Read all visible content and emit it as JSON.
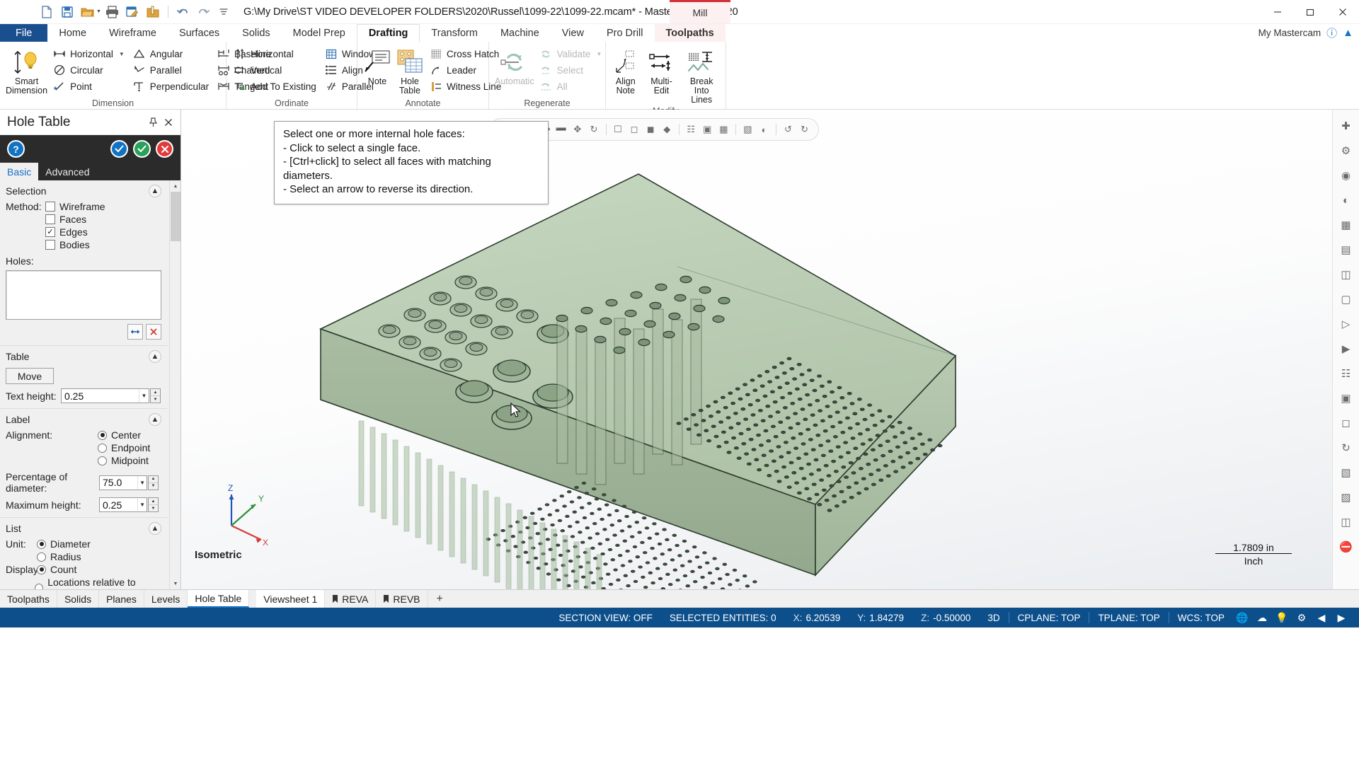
{
  "titlebar": {
    "quick_access": [
      {
        "name": "new-icon",
        "label": "New"
      },
      {
        "name": "save-icon",
        "label": "Save"
      },
      {
        "name": "open-folder-icon",
        "label": "Open"
      },
      {
        "name": "print-icon",
        "label": "Print"
      },
      {
        "name": "print-preview-icon",
        "label": "Print Preview"
      },
      {
        "name": "zip2go-icon",
        "label": "Zip2Go"
      },
      {
        "name": "undo-icon",
        "label": "Undo"
      },
      {
        "name": "redo-icon",
        "label": "Redo"
      },
      {
        "name": "customize-qat-icon",
        "label": "Customize Quick Access Toolbar"
      }
    ],
    "document_path": "G:\\My Drive\\ST VIDEO DEVELOPER FOLDERS\\2020\\Russel\\1099-22\\1099-22.mcam* - Mastercam Mill 2020",
    "machine_badge": "Mill",
    "window_controls": {
      "minimize": "–",
      "maximize": "❐",
      "close": "✕"
    }
  },
  "ribbon": {
    "tabs": [
      {
        "label": "File",
        "state": "file"
      },
      {
        "label": "Home",
        "state": "normal"
      },
      {
        "label": "Wireframe",
        "state": "normal"
      },
      {
        "label": "Surfaces",
        "state": "normal"
      },
      {
        "label": "Solids",
        "state": "normal"
      },
      {
        "label": "Model Prep",
        "state": "normal"
      },
      {
        "label": "Drafting",
        "state": "active"
      },
      {
        "label": "Transform",
        "state": "normal"
      },
      {
        "label": "Machine",
        "state": "normal"
      },
      {
        "label": "View",
        "state": "normal"
      },
      {
        "label": "Pro Drill",
        "state": "normal"
      },
      {
        "label": "Toolpaths",
        "state": "toolpaths"
      }
    ],
    "account_label": "My Mastercam",
    "groups": {
      "dimension": {
        "label": "Dimension",
        "big": {
          "label_line1": "Smart",
          "label_line2": "Dimension",
          "icon": "smart-dimension-icon"
        },
        "col1": [
          {
            "label": "Horizontal",
            "icon": "horizontal-dimension-icon",
            "dropdown": true
          },
          {
            "label": "Circular",
            "icon": "circular-dimension-icon",
            "dropdown": false
          },
          {
            "label": "Point",
            "icon": "point-dimension-icon",
            "dropdown": false
          }
        ],
        "col2": [
          {
            "label": "Angular",
            "icon": "angular-dimension-icon"
          },
          {
            "label": "Parallel",
            "icon": "parallel-dimension-icon"
          },
          {
            "label": "Perpendicular",
            "icon": "perpendicular-dimension-icon"
          }
        ],
        "col3": [
          {
            "label": "Baseline",
            "icon": "baseline-dimension-icon"
          },
          {
            "label": "Chained",
            "icon": "chained-dimension-icon"
          },
          {
            "label": "Tangent",
            "icon": "tangent-dimension-icon"
          }
        ]
      },
      "ordinate": {
        "label": "Ordinate",
        "items": [
          {
            "label": "Horizontal",
            "icon": "ordinate-horizontal-icon"
          },
          {
            "label": "Vertical",
            "icon": "ordinate-vertical-icon"
          },
          {
            "label": "Add To Existing",
            "icon": "add-to-existing-icon"
          },
          {
            "label": "Window",
            "icon": "window-icon"
          },
          {
            "label": "Align",
            "icon": "align-icon"
          },
          {
            "label": "Parallel",
            "icon": "ordinate-parallel-icon"
          }
        ]
      },
      "annotate": {
        "label": "Annotate",
        "big": [
          {
            "label_line1": "Note",
            "label_line2": "",
            "icon": "note-icon"
          },
          {
            "label_line1": "Hole",
            "label_line2": "Table",
            "icon": "hole-table-icon"
          }
        ],
        "items": [
          {
            "label": "Cross Hatch",
            "icon": "cross-hatch-icon"
          },
          {
            "label": "Leader",
            "icon": "leader-icon"
          },
          {
            "label": "Witness Line",
            "icon": "witness-line-icon"
          }
        ]
      },
      "regenerate": {
        "label": "Regenerate",
        "big": {
          "label_line1": "Automatic",
          "label_line2": "",
          "icon": "automatic-regen-icon",
          "disabled": true
        },
        "items": [
          {
            "label": "Validate",
            "icon": "validate-icon",
            "dropdown": true,
            "disabled": true
          },
          {
            "label": "Select",
            "icon": "select-regen-icon",
            "disabled": true
          },
          {
            "label": "All",
            "icon": "all-regen-icon",
            "disabled": true
          }
        ]
      },
      "modify": {
        "label": "Modify",
        "big": [
          {
            "label_line1": "Align",
            "label_line2": "Note",
            "icon": "align-note-icon"
          },
          {
            "label_line1": "Multi-Edit",
            "label_line2": "",
            "icon": "multi-edit-icon"
          },
          {
            "label_line1": "Break",
            "label_line2": "Into Lines",
            "icon": "break-into-lines-icon"
          }
        ]
      }
    }
  },
  "hole_table_panel": {
    "title": "Hole Table",
    "header_buttons": [
      {
        "name": "pin-icon",
        "glyph": "·|·"
      },
      {
        "name": "close-icon",
        "glyph": "✕"
      }
    ],
    "toolbar_buttons": [
      {
        "name": "help-button",
        "glyph": "?",
        "style": "cb-help"
      },
      {
        "name": "apply-button",
        "glyph": "✔",
        "style": "cb-apply"
      },
      {
        "name": "ok-button",
        "glyph": "✔",
        "style": "cb-ok"
      },
      {
        "name": "cancel-button",
        "glyph": "✕",
        "style": "cb-cancel"
      }
    ],
    "tabs": [
      {
        "label": "Basic",
        "active": true
      },
      {
        "label": "Advanced",
        "active": false
      }
    ],
    "sections": {
      "selection": {
        "title": "Selection",
        "method_label": "Method:",
        "methods": [
          {
            "label": "Wireframe",
            "checked": false
          },
          {
            "label": "Faces",
            "checked": false
          },
          {
            "label": "Edges",
            "checked": true
          },
          {
            "label": "Bodies",
            "checked": false
          }
        ],
        "holes_label": "Holes:",
        "holes_value": "",
        "action_buttons": [
          {
            "name": "reverse-direction-button",
            "glyph": "↔"
          },
          {
            "name": "delete-holes-button",
            "glyph": "✕"
          }
        ]
      },
      "table": {
        "title": "Table",
        "move_button": "Move",
        "text_height_label": "Text height:",
        "text_height_value": "0.25"
      },
      "label": {
        "title": "Label",
        "alignment_label": "Alignment:",
        "alignment_options": [
          {
            "label": "Center",
            "selected": true
          },
          {
            "label": "Endpoint",
            "selected": false
          },
          {
            "label": "Midpoint",
            "selected": false
          }
        ],
        "percentage_label": "Percentage of diameter:",
        "percentage_value": "75.0",
        "max_height_label": "Maximum height:",
        "max_height_value": "0.25"
      },
      "list": {
        "title": "List",
        "unit_label": "Unit:",
        "unit_options": [
          {
            "label": "Diameter",
            "selected": true
          },
          {
            "label": "Radius",
            "selected": false
          }
        ],
        "display_label": "Display:",
        "display_options": [
          {
            "label": "Count",
            "selected": true
          },
          {
            "label": "Locations relative to Cplane",
            "selected": false
          }
        ]
      }
    }
  },
  "graphics": {
    "tooltip_lines": [
      "Select one or more internal hole faces:",
      "- Click to select a single face.",
      "- [Ctrl+click] to select all faces with matching diameters.",
      "- Select an arrow to reverse its direction."
    ],
    "viewport_label": "Isometric",
    "scale_value": "1.7809 in",
    "scale_unit": "Inch",
    "axis_labels": {
      "x": "X",
      "y": "Y",
      "z": "Z"
    },
    "axis_colors": {
      "x": "#d43b3b",
      "y": "#2f8f3f",
      "z": "#2255bb"
    },
    "model_color": "#b9ccb4",
    "model_edge_color": "#2c3b2c",
    "float_toolbar_icons": [
      "fit-icon",
      "zoom-window-icon",
      "zoom-in-icon",
      "zoom-out-icon",
      "pan-icon",
      "rotate-icon",
      "top-view-icon",
      "front-view-icon",
      "right-view-icon",
      "isometric-view-icon",
      "wireframe-shade-icon",
      "shaded-icon",
      "shaded-edges-icon",
      "section-view-icon",
      "translucency-icon",
      "undo-view-icon",
      "redo-view-icon"
    ]
  },
  "right_rail": {
    "icons": [
      "add-viewsheet-icon",
      "wireframe-toggle-icon",
      "shading-toggle-icon",
      "translucency-toggle-icon",
      "material-icon",
      "hidden-lines-icon",
      "edges-icon",
      "backplot-icon",
      "verify-icon",
      "simulate-icon",
      "toolpath-display-icon",
      "fit-screen-icon",
      "unzoom-icon",
      "dynamic-rotate-icon",
      "section-plane-icon",
      "clip-icon",
      "measure-icon",
      "no-entry-icon"
    ]
  },
  "bottom_tabs": {
    "manager_tabs": [
      {
        "label": "Toolpaths",
        "active": false
      },
      {
        "label": "Solids",
        "active": false
      },
      {
        "label": "Planes",
        "active": false
      },
      {
        "label": "Levels",
        "active": false
      },
      {
        "label": "Hole Table",
        "active": true
      }
    ],
    "viewsheets": [
      {
        "label": "Viewsheet 1",
        "icon": null,
        "active": true
      },
      {
        "label": "REVA",
        "icon": "bookmark-icon",
        "active": false
      },
      {
        "label": "REVB",
        "icon": "bookmark-icon",
        "active": false
      }
    ],
    "add_viewsheet": "+"
  },
  "statusbar": {
    "section_view": "SECTION VIEW: OFF",
    "selected_entities": "SELECTED ENTITIES: 0",
    "coords": [
      {
        "key": "X:",
        "value": "6.20539"
      },
      {
        "key": "Y:",
        "value": "1.84279"
      },
      {
        "key": "Z:",
        "value": "-0.50000"
      }
    ],
    "mode_3d": "3D",
    "cplane": "CPLANE: TOP",
    "tplane": "TPLANE: TOP",
    "wcs": "WCS: TOP",
    "right_icons": [
      "globe-icon",
      "cloud-icon",
      "lightbulb-icon",
      "gear-icon",
      "arrow-left-icon",
      "arrow-right-icon"
    ]
  }
}
